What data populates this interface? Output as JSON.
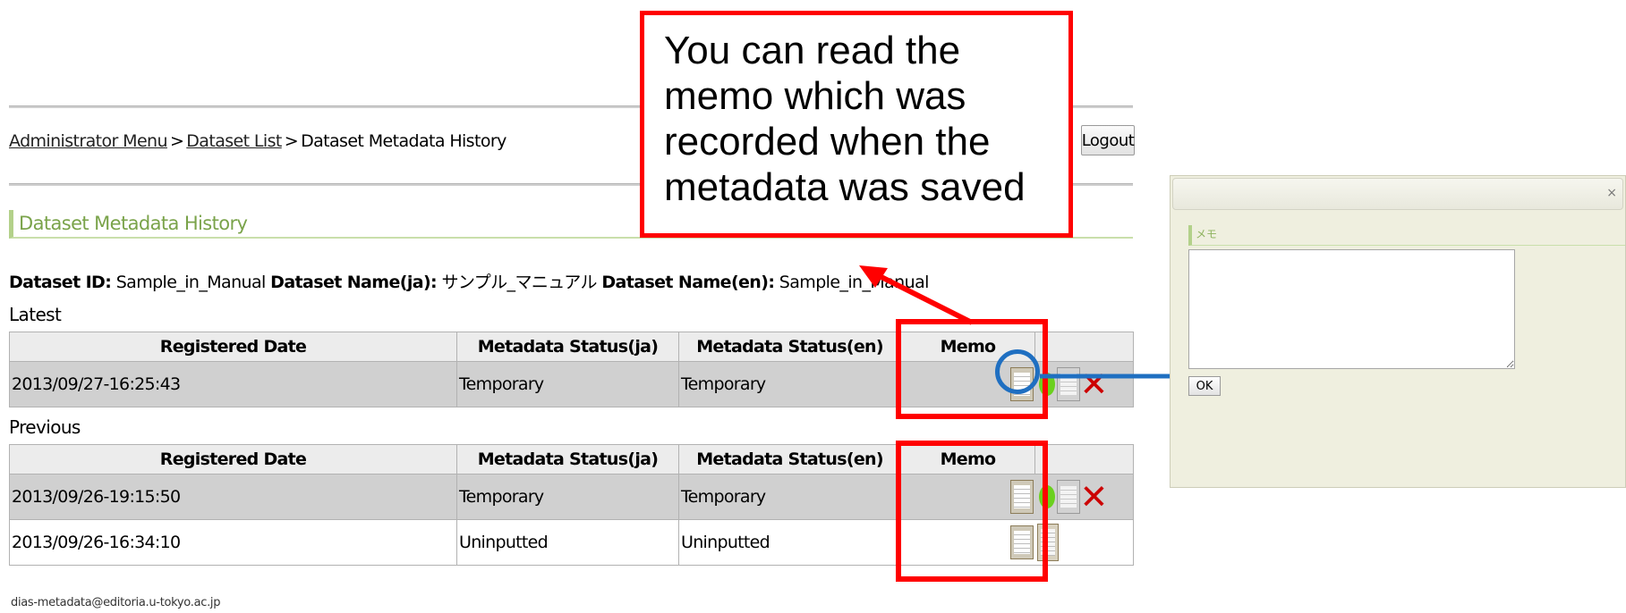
{
  "breadcrumb": {
    "items": [
      "Administrator Menu",
      "Dataset List"
    ],
    "current": "Dataset Metadata History",
    "separator": ">"
  },
  "header": {
    "logout_label": "Logout"
  },
  "page_title": "Dataset Metadata History",
  "dataset_info": {
    "id_label": "Dataset ID:",
    "id_value": "Sample_in_Manual",
    "name_ja_label": "Dataset Name(ja):",
    "name_ja_value": "サンプル_マニュアル",
    "name_en_label": "Dataset Name(en):",
    "name_en_value": "Sample_in_Manual"
  },
  "latest": {
    "label": "Latest",
    "columns": [
      "Registered Date",
      "Metadata Status(ja)",
      "Metadata Status(en)",
      "Memo"
    ],
    "rows": [
      {
        "date": "2013/09/27-16:25:43",
        "status_ja": "Temporary",
        "status_en": "Temporary"
      }
    ]
  },
  "previous": {
    "label": "Previous",
    "columns": [
      "Registered Date",
      "Metadata Status(ja)",
      "Metadata Status(en)",
      "Memo"
    ],
    "rows": [
      {
        "date": "2013/09/26-19:15:50",
        "status_ja": "Temporary",
        "status_en": "Temporary"
      },
      {
        "date": "2013/09/26-16:34:10",
        "status_ja": "Uninputted",
        "status_en": "Uninputted"
      }
    ]
  },
  "footer": {
    "email": "dias-metadata@editoria.u-tokyo.ac.jp"
  },
  "callout": {
    "lines": [
      "You can read the",
      "memo which was",
      "recorded when the",
      "metadata was saved"
    ]
  },
  "dialog": {
    "close_symbol": "×",
    "section_label": "メモ",
    "ok_label": "OK"
  },
  "icons": {
    "memo": "memo-icon",
    "status": "green-status-icon",
    "edit": "edit-icon",
    "delete": "delete-icon"
  },
  "colors": {
    "callout_border": "#ff0000",
    "highlight_circle": "#1f6fc1",
    "arrow_red": "#ff0000",
    "arrow_blue": "#1f6fc1",
    "section_accent": "#b3d18a",
    "dialog_bg": "#efefdf"
  }
}
